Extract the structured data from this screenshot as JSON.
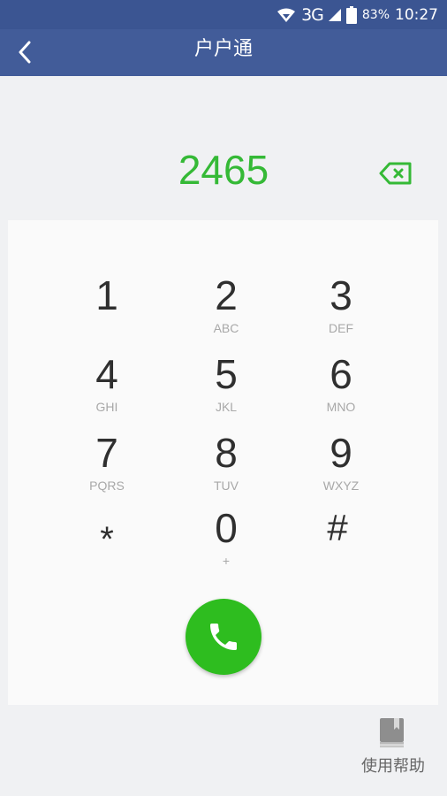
{
  "status_bar": {
    "network": "3G",
    "battery": "83%",
    "time": "10:27"
  },
  "header": {
    "title": "户户通"
  },
  "dialer": {
    "number": "2465",
    "keys": [
      {
        "digit": "1",
        "letters": ""
      },
      {
        "digit": "2",
        "letters": "ABC"
      },
      {
        "digit": "3",
        "letters": "DEF"
      },
      {
        "digit": "4",
        "letters": "GHI"
      },
      {
        "digit": "5",
        "letters": "JKL"
      },
      {
        "digit": "6",
        "letters": "MNO"
      },
      {
        "digit": "7",
        "letters": "PQRS"
      },
      {
        "digit": "8",
        "letters": "TUV"
      },
      {
        "digit": "9",
        "letters": "WXYZ"
      },
      {
        "digit": "*",
        "letters": ""
      },
      {
        "digit": "0",
        "letters": "+"
      },
      {
        "digit": "#",
        "letters": ""
      }
    ]
  },
  "footer": {
    "help_label": "使用帮助"
  },
  "colors": {
    "status_bar": "#3b5592",
    "app_bar": "#425c99",
    "accent_green": "#35b936",
    "call_button": "#2ebd1f",
    "background": "#f0f1f3",
    "keypad_background": "#fafafa",
    "digit_text": "#2f2f2f",
    "letters_text": "#a8a8a8"
  },
  "icons": {
    "back": "chevron-left-icon",
    "delete": "backspace-icon",
    "call": "phone-icon",
    "help": "book-icon",
    "wifi": "wifi-icon",
    "signal": "signal-icon",
    "battery": "battery-icon"
  }
}
